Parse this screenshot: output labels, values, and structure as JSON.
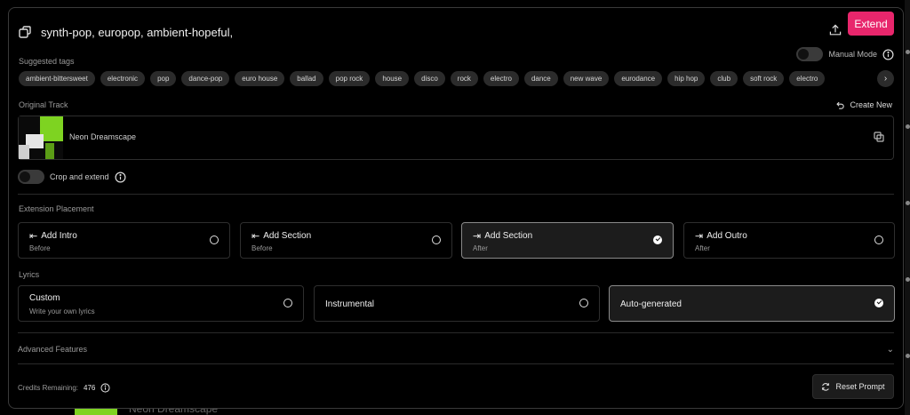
{
  "prompt": {
    "text": "synth-pop, europop, ambient-hopeful,"
  },
  "header": {
    "extend_label": "Extend"
  },
  "manual_mode": {
    "label": "Manual Mode"
  },
  "suggested_tags": {
    "label": "Suggested tags",
    "tags": [
      "ambient-bittersweet",
      "electronic",
      "pop",
      "dance-pop",
      "euro house",
      "ballad",
      "pop rock",
      "house",
      "disco",
      "rock",
      "electro",
      "dance",
      "new wave",
      "eurodance",
      "hip hop",
      "club",
      "soft rock",
      "electro"
    ]
  },
  "original_track": {
    "label": "Original Track",
    "create_new_label": "Create New",
    "track_name": "Neon Dreamscape"
  },
  "crop": {
    "label": "Crop and extend"
  },
  "extension_placement": {
    "label": "Extension Placement",
    "options": [
      {
        "title": "Add Intro",
        "sub": "Before",
        "selected": false
      },
      {
        "title": "Add Section",
        "sub": "Before",
        "selected": false
      },
      {
        "title": "Add Section",
        "sub": "After",
        "selected": true
      },
      {
        "title": "Add Outro",
        "sub": "After",
        "selected": false
      }
    ]
  },
  "lyrics": {
    "label": "Lyrics",
    "options": [
      {
        "title": "Custom",
        "sub": "Write your own lyrics",
        "selected": false
      },
      {
        "title": "Instrumental",
        "sub": "",
        "selected": false
      },
      {
        "title": "Auto-generated",
        "sub": "",
        "selected": true
      }
    ]
  },
  "advanced": {
    "label": "Advanced Features"
  },
  "footer": {
    "credits_label": "Credits Remaining:",
    "credits_value": "476",
    "reset_label": "Reset Prompt"
  },
  "background": {
    "peek_text": "Neon Dreamscape"
  },
  "colors": {
    "accent": "#e8266c",
    "art_green": "#7ed321"
  }
}
